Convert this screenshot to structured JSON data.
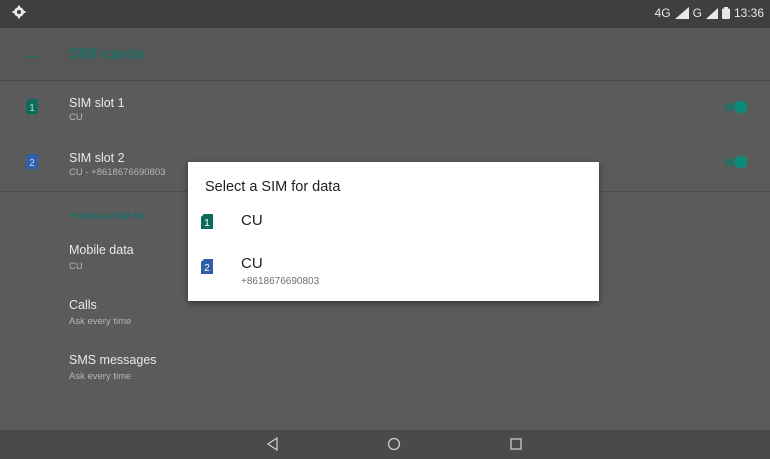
{
  "status_bar": {
    "left_icon": "settings-gear-icon",
    "network": "4G",
    "sim2_network": "G",
    "time": "13:36"
  },
  "app_bar": {
    "back_icon": "arrow-back-icon",
    "title": "SIM cards"
  },
  "sim_slots": [
    {
      "title": "SIM slot 1",
      "subtitle": "CU",
      "badge": "1",
      "badge_color": "#0d6b5e",
      "enabled": true
    },
    {
      "title": "SIM slot 2",
      "subtitle": "CU - +8618676690803",
      "badge": "2",
      "badge_color": "#2f5fa8",
      "enabled": true
    }
  ],
  "preferred_section": {
    "header": "Preferred SIM for",
    "items": [
      {
        "title": "Mobile data",
        "subtitle": "CU"
      },
      {
        "title": "Calls",
        "subtitle": "Ask every time"
      },
      {
        "title": "SMS messages",
        "subtitle": "Ask every time"
      }
    ]
  },
  "dialog": {
    "title": "Select a SIM for data",
    "options": [
      {
        "badge": "1",
        "badge_color": "#0d6b5e",
        "name": "CU",
        "number": ""
      },
      {
        "badge": "2",
        "badge_color": "#2f5fa8",
        "name": "CU",
        "number": "+8618676690803"
      }
    ]
  },
  "nav_bar": {
    "back": "nav-back-icon",
    "home": "nav-home-icon",
    "recents": "nav-recents-icon"
  },
  "colors": {
    "accent": "#1a6f64",
    "toggle_on": "#0d8a78"
  }
}
